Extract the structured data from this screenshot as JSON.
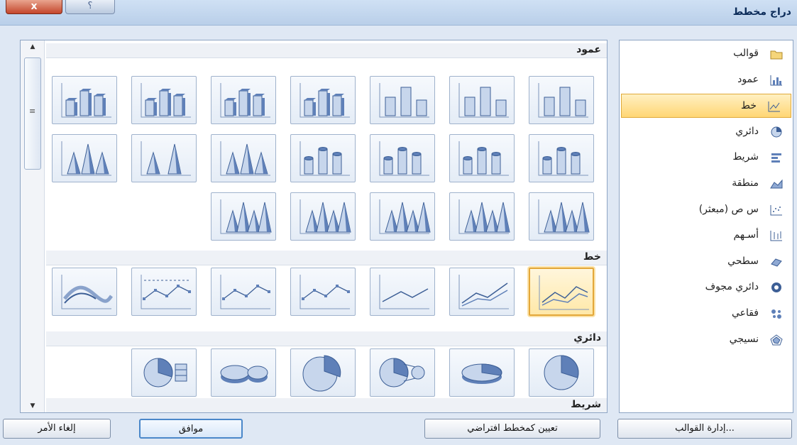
{
  "window": {
    "title": "دراج مخطط",
    "close_label": "x",
    "help_label": "؟"
  },
  "gallery": {
    "sections": {
      "column": "عمود",
      "line": "خط",
      "pie": "دائري",
      "bar": "شريط"
    }
  },
  "categories": [
    {
      "label": "قوالب",
      "icon": "folder-icon",
      "selected": false
    },
    {
      "label": "عمود",
      "icon": "column-chart-icon",
      "selected": false
    },
    {
      "label": "خط",
      "icon": "line-chart-icon",
      "selected": true
    },
    {
      "label": "دائري",
      "icon": "pie-chart-icon",
      "selected": false
    },
    {
      "label": "شريط",
      "icon": "bar-chart-icon",
      "selected": false
    },
    {
      "label": "منطقة",
      "icon": "area-chart-icon",
      "selected": false
    },
    {
      "label": "س ص (مبعثر)",
      "icon": "scatter-chart-icon",
      "selected": false
    },
    {
      "label": "أسـهم",
      "icon": "stock-chart-icon",
      "selected": false
    },
    {
      "label": "سطحي",
      "icon": "surface-chart-icon",
      "selected": false
    },
    {
      "label": "دائري مجوف",
      "icon": "doughnut-chart-icon",
      "selected": false
    },
    {
      "label": "فقاعي",
      "icon": "bubble-chart-icon",
      "selected": false
    },
    {
      "label": "نسيجي",
      "icon": "radar-chart-icon",
      "selected": false
    }
  ],
  "buttons": {
    "manage_templates": "إدارة القوالب...",
    "set_default": "تعيين كمخطط افتراضي",
    "ok": "موافق",
    "cancel": "إلغاء الأمر"
  },
  "colors": {
    "accent": "#ffd674",
    "selection_border": "#e3a739",
    "chart_blue": "#5f80b8"
  }
}
